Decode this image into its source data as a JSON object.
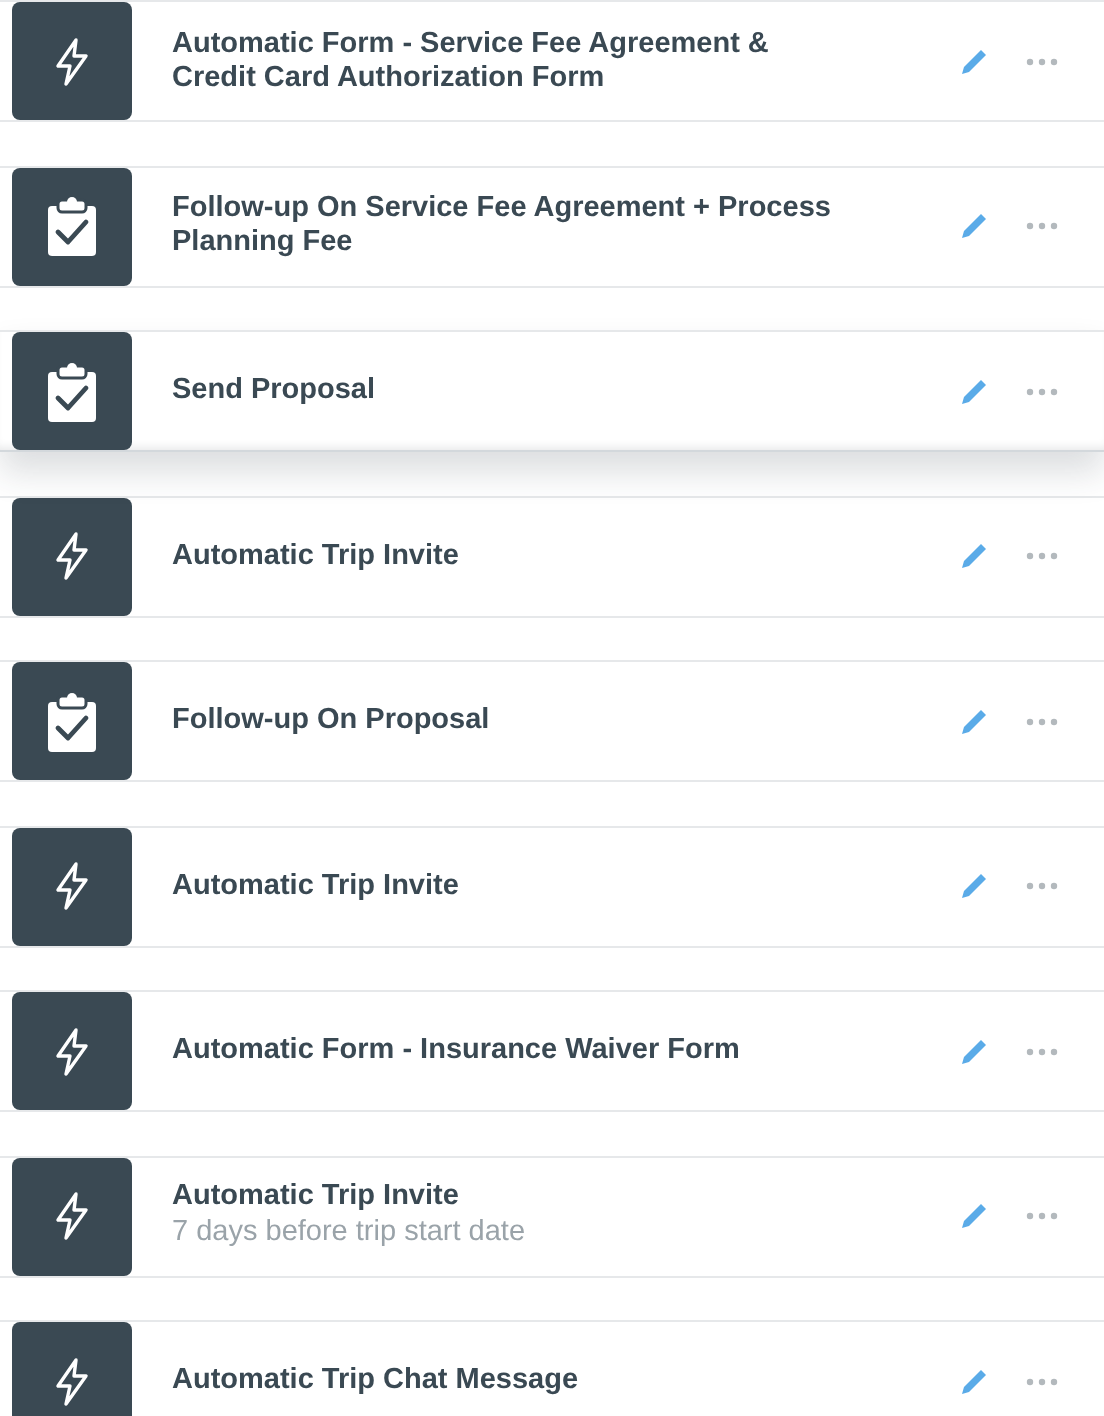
{
  "steps": [
    {
      "kind": "automation",
      "title": "Automatic Form - Service Fee Agreement & Credit Card Authorization Form",
      "raised": false
    },
    {
      "kind": "task",
      "title": "Follow-up On Service Fee Agreement + Process Planning Fee",
      "raised": false
    },
    {
      "kind": "task",
      "title": "Send Proposal",
      "raised": true
    },
    {
      "kind": "automation",
      "title": "Automatic Trip Invite",
      "raised": false
    },
    {
      "kind": "task",
      "title": "Follow-up On Proposal",
      "raised": false
    },
    {
      "kind": "automation",
      "title": "Automatic Trip Invite",
      "raised": false
    },
    {
      "kind": "automation",
      "title": "Automatic Form - Insurance Waiver Form",
      "raised": false
    },
    {
      "kind": "automation",
      "title": "Automatic Trip Invite",
      "subtitle": "7 days before trip start date",
      "raised": false
    },
    {
      "kind": "automation",
      "title": "Automatic Trip Chat Message"
    }
  ]
}
